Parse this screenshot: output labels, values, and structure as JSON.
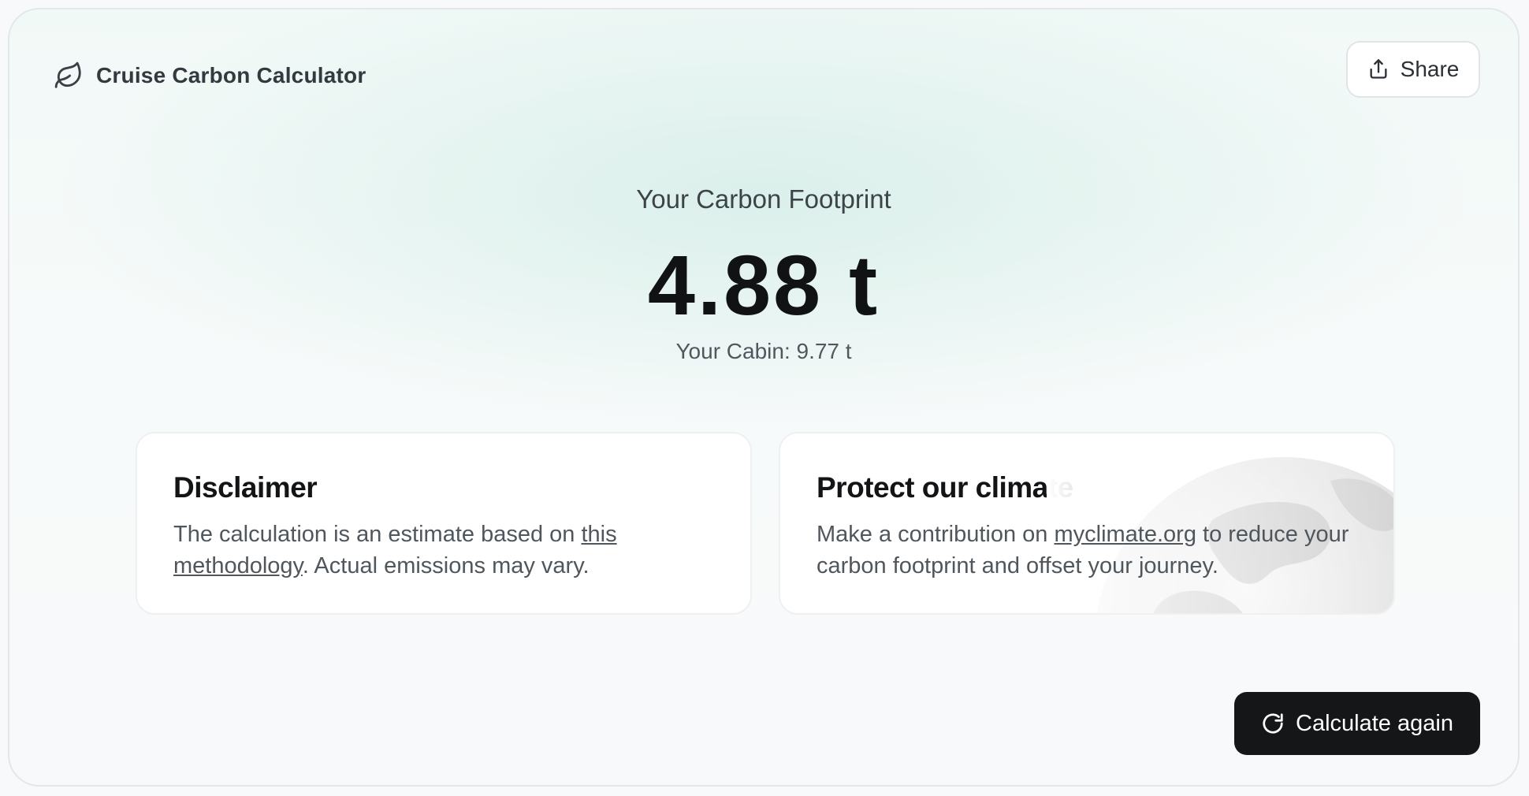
{
  "header": {
    "logo_icon": "leaf-icon",
    "title": "Cruise Carbon Calculator",
    "share": {
      "icon": "share-icon",
      "label": "Share"
    }
  },
  "result": {
    "heading": "Your Carbon Footprint",
    "value": "4.88 t",
    "cabin": "Your Cabin: 9.77 t"
  },
  "disclaimer": {
    "title": "Disclaimer",
    "text_before": "The calculation is an estimate based on ",
    "link": "this methodology",
    "text_after": ". Actual emissions may vary."
  },
  "climate": {
    "title": "Protect our climate",
    "text_before": "Make a contribution on ",
    "link": "myclimate.org",
    "text_after": " to reduce your carbon footprint and offset your journey.",
    "decoration": "globe-image"
  },
  "actions": {
    "calculate_again": {
      "icon": "refresh-icon",
      "label": "Calculate again"
    }
  },
  "colors": {
    "primary_button": "#141618",
    "text_dark": "#121416",
    "text_muted": "#4f575d",
    "background_tint": "#f1f9f7"
  }
}
